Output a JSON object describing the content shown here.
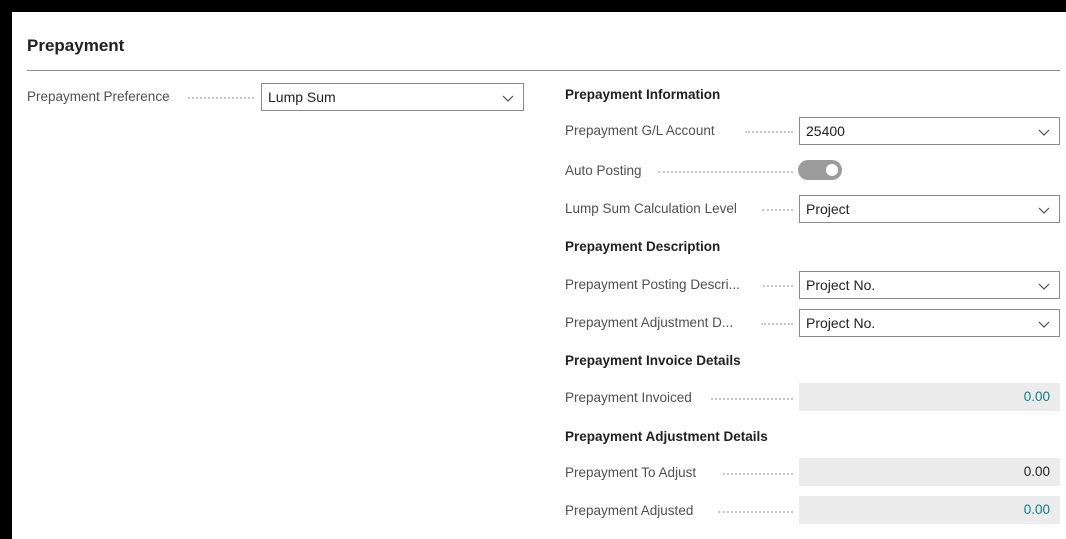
{
  "page": {
    "title": "Prepayment"
  },
  "left": {
    "preference_label": "Prepayment Preference",
    "preference_value": "Lump Sum"
  },
  "info": {
    "heading": "Prepayment Information",
    "gl_account_label": "Prepayment  G/L Account",
    "gl_account_value": "25400",
    "auto_posting_label": "Auto Posting",
    "auto_posting_on": true,
    "calc_level_label": "Lump Sum Calculation Level",
    "calc_level_value": "Project"
  },
  "description": {
    "heading": "Prepayment Description",
    "posting_desc_label": "Prepayment Posting Descri...",
    "posting_desc_value": "Project No.",
    "adjustment_desc_label": "Prepayment Adjustment D...",
    "adjustment_desc_value": "Project No."
  },
  "invoice": {
    "heading": "Prepayment Invoice Details",
    "invoiced_label": "Prepayment Invoiced",
    "invoiced_value": "0.00"
  },
  "adjustment": {
    "heading": "Prepayment Adjustment Details",
    "to_adjust_label": "Prepayment To Adjust",
    "to_adjust_value": "0.00",
    "adjusted_label": "Prepayment Adjusted",
    "adjusted_value": "0.00"
  },
  "colors": {
    "link": "#0f7b8a",
    "text": "#212121",
    "readonly_bg": "#ececec"
  }
}
